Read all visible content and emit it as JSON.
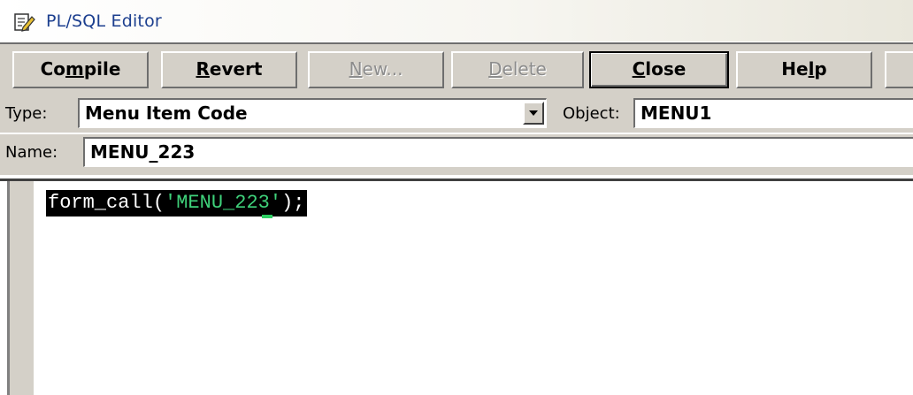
{
  "window": {
    "title": "PL/SQL Editor",
    "icon": "edit-document-icon"
  },
  "toolbar": {
    "buttons": [
      {
        "id": "compile",
        "pre": "Co",
        "mnemonic": "m",
        "post": "pile",
        "enabled": true
      },
      {
        "id": "revert",
        "pre": "",
        "mnemonic": "R",
        "post": "evert",
        "enabled": true
      },
      {
        "id": "new",
        "pre": "",
        "mnemonic": "N",
        "post": "ew...",
        "enabled": false
      },
      {
        "id": "delete",
        "pre": "",
        "mnemonic": "D",
        "post": "elete",
        "enabled": false
      },
      {
        "id": "close",
        "pre": "",
        "mnemonic": "C",
        "post": "lose",
        "enabled": true,
        "default": true
      },
      {
        "id": "help",
        "pre": "He",
        "mnemonic": "l",
        "post": "p",
        "enabled": true
      }
    ]
  },
  "fields": {
    "type_label": "Type:",
    "type_value": "Menu Item Code",
    "object_label": "Object:",
    "object_value": "MENU1",
    "name_label": "Name:",
    "name_value": "MENU_223"
  },
  "editor": {
    "tokens": {
      "func": "form_call",
      "open": "(",
      "string": "'MENU_223'",
      "close": ");"
    },
    "colors": {
      "background_selection": "#000000",
      "plain": "#ffffff",
      "string": "#3fd17a"
    }
  }
}
